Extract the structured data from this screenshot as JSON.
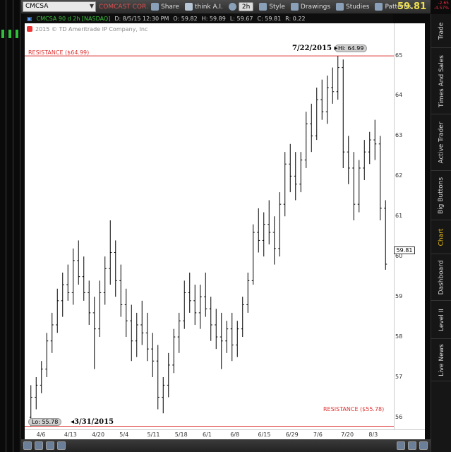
{
  "toolbar": {
    "symbol": "CMCSA",
    "description": "COMCAST COR...",
    "share_label": "Share",
    "think_label": "think A.I.",
    "timeframe": "2h",
    "style_label": "Style",
    "drawings_label": "Drawings",
    "studies_label": "Studies",
    "patterns_label": "Patterns",
    "last_price": "59.81",
    "change_abs": "-2.65",
    "change_pct": "-4.57%"
  },
  "infobar": {
    "series": "CMCSA 90 d 2h [NASDAQ]",
    "date": "D: 8/5/15 12:30 PM",
    "open": "O: 59.82",
    "high": "H: 59.89",
    "low": "L: 59.67",
    "close": "C: 59.81",
    "range": "R: 0.22"
  },
  "copyright": "2015 © TD Ameritrade IP Company, Inc",
  "annotations": {
    "resistance_top": "RESISTANCE ($64.99)",
    "resistance_bottom": "RESISTANCE ($55.78)",
    "hi_label": "Hi: 64.99",
    "lo_label": "Lo: 55.78",
    "hi_date": "7/22/2015",
    "lo_date": "3/31/2015",
    "current_price": "59.81"
  },
  "right_tabs": [
    "Trade",
    "Times And Sales",
    "Active Trader",
    "Big Buttons",
    "Chart",
    "Dashboard",
    "Level II",
    "Live News"
  ],
  "colors": {
    "resistance": "#d33",
    "candle": "#000",
    "price_up": "#f0e04a",
    "change_down": "#e33",
    "active_tab": "#f0c419"
  },
  "icons": [
    "dropdown-icon",
    "share-icon",
    "think-icon",
    "clock-icon",
    "style-icon",
    "drawings-icon",
    "studies-icon",
    "patterns-icon",
    "zoom-icon",
    "settings-icon"
  ],
  "chart_data": {
    "type": "bar",
    "title": "",
    "symbol": "CMCSA",
    "resistance_levels": [
      64.99,
      55.78
    ],
    "ylim": [
      55.7,
      65.8
    ],
    "y_ticks": [
      56,
      57,
      58,
      59,
      60,
      61,
      62,
      63,
      64,
      65
    ],
    "x_ticks": [
      "4/6",
      "4/13",
      "4/20",
      "5/4",
      "5/11",
      "5/18",
      "6/1",
      "6/8",
      "6/15",
      "6/29",
      "7/6",
      "7/20",
      "8/3"
    ],
    "series": [
      {
        "values": [
          [
            56.0,
            56.8,
            55.78,
            56.5
          ],
          [
            56.5,
            57.0,
            56.2,
            56.8
          ],
          [
            56.8,
            57.4,
            56.6,
            57.2
          ],
          [
            57.2,
            58.1,
            57.0,
            57.9
          ],
          [
            57.9,
            58.6,
            57.6,
            58.3
          ],
          [
            58.3,
            59.2,
            58.1,
            58.9
          ],
          [
            58.9,
            59.6,
            58.5,
            59.3
          ],
          [
            59.3,
            59.8,
            58.9,
            59.1
          ],
          [
            59.1,
            60.2,
            58.8,
            59.9
          ],
          [
            59.9,
            60.4,
            59.3,
            59.5
          ],
          [
            59.5,
            60.0,
            58.9,
            59.1
          ],
          [
            59.1,
            59.4,
            58.3,
            58.6
          ],
          [
            58.6,
            59.0,
            57.2,
            58.2
          ],
          [
            58.2,
            59.4,
            58.0,
            59.1
          ],
          [
            59.1,
            60.0,
            58.8,
            59.7
          ],
          [
            59.7,
            60.9,
            59.3,
            60.1
          ],
          [
            60.1,
            60.4,
            59.0,
            59.4
          ],
          [
            59.4,
            59.8,
            58.5,
            58.8
          ],
          [
            58.8,
            59.2,
            58.0,
            58.4
          ],
          [
            58.4,
            58.8,
            57.4,
            57.9
          ],
          [
            57.9,
            58.6,
            57.5,
            58.3
          ],
          [
            58.3,
            58.9,
            57.8,
            58.1
          ],
          [
            58.1,
            58.6,
            57.4,
            57.7
          ],
          [
            57.7,
            58.1,
            57.0,
            57.4
          ],
          [
            57.4,
            57.8,
            56.2,
            56.5
          ],
          [
            56.5,
            57.0,
            56.1,
            56.8
          ],
          [
            56.8,
            57.6,
            56.5,
            57.3
          ],
          [
            57.3,
            58.2,
            57.1,
            58.0
          ],
          [
            58.0,
            58.6,
            57.6,
            58.4
          ],
          [
            58.4,
            59.4,
            58.2,
            59.1
          ],
          [
            59.1,
            59.6,
            58.6,
            58.9
          ],
          [
            58.9,
            59.3,
            58.3,
            58.6
          ],
          [
            58.6,
            59.3,
            58.2,
            59.0
          ],
          [
            59.0,
            59.6,
            58.5,
            58.7
          ],
          [
            58.7,
            59.0,
            57.9,
            58.3
          ],
          [
            58.3,
            58.7,
            57.7,
            58.0
          ],
          [
            58.0,
            58.6,
            57.2,
            57.9
          ],
          [
            57.9,
            58.4,
            57.6,
            58.2
          ],
          [
            58.2,
            58.6,
            57.4,
            57.8
          ],
          [
            57.8,
            58.4,
            57.5,
            58.2
          ],
          [
            58.2,
            59.0,
            58.0,
            58.8
          ],
          [
            58.8,
            59.6,
            58.6,
            59.4
          ],
          [
            59.4,
            60.8,
            59.3,
            60.6
          ],
          [
            60.6,
            61.2,
            60.1,
            60.4
          ],
          [
            60.4,
            61.1,
            60.0,
            60.8
          ],
          [
            60.8,
            61.4,
            60.3,
            60.6
          ],
          [
            60.6,
            61.0,
            59.8,
            60.2
          ],
          [
            60.2,
            61.6,
            60.0,
            61.3
          ],
          [
            61.3,
            62.6,
            61.0,
            62.3
          ],
          [
            62.3,
            62.8,
            61.6,
            62.0
          ],
          [
            62.0,
            62.6,
            61.4,
            61.8
          ],
          [
            61.8,
            62.6,
            61.6,
            62.4
          ],
          [
            62.4,
            63.6,
            62.2,
            63.3
          ],
          [
            63.3,
            63.8,
            62.6,
            63.0
          ],
          [
            63.0,
            64.2,
            62.9,
            63.9
          ],
          [
            63.9,
            64.4,
            63.4,
            63.6
          ],
          [
            63.6,
            64.5,
            63.3,
            64.2
          ],
          [
            64.2,
            64.7,
            63.8,
            64.1
          ],
          [
            64.1,
            64.99,
            63.9,
            64.7
          ],
          [
            64.7,
            64.9,
            62.2,
            62.6
          ],
          [
            62.6,
            63.0,
            61.8,
            62.2
          ],
          [
            62.2,
            62.6,
            60.9,
            61.3
          ],
          [
            61.3,
            62.4,
            61.1,
            62.2
          ],
          [
            62.2,
            62.9,
            61.9,
            62.6
          ],
          [
            62.6,
            63.1,
            62.3,
            62.9
          ],
          [
            62.9,
            63.4,
            62.4,
            62.8
          ],
          [
            62.8,
            63.0,
            60.9,
            61.2
          ],
          [
            61.2,
            61.4,
            59.67,
            59.81
          ]
        ]
      }
    ]
  }
}
